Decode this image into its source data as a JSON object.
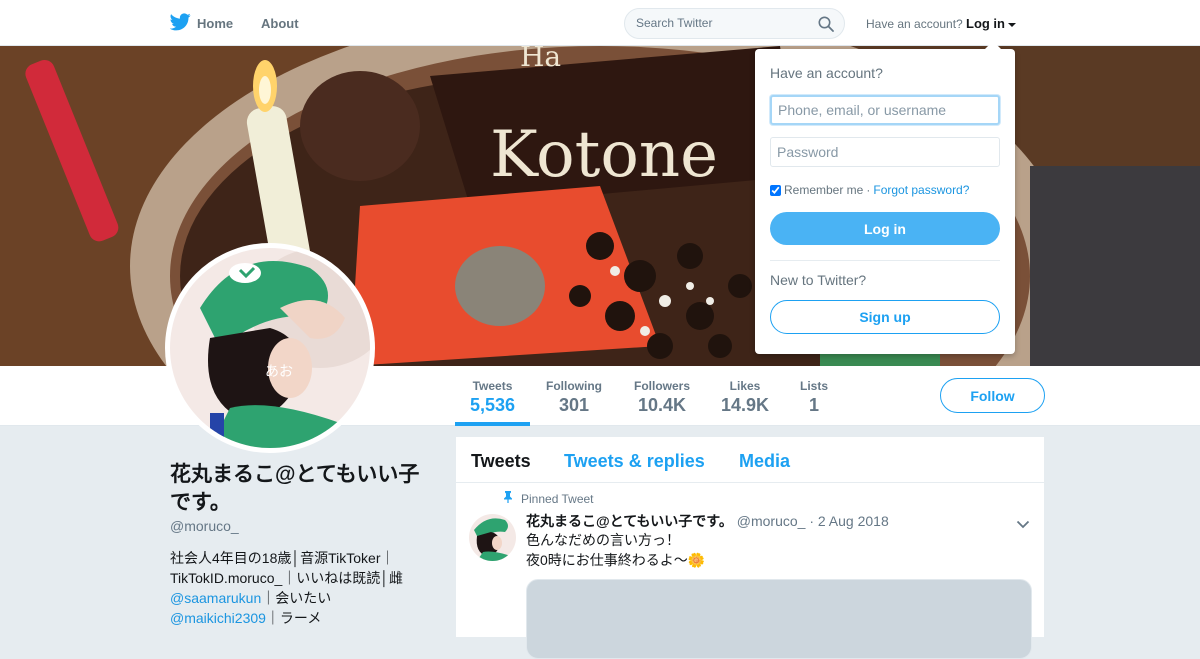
{
  "nav": {
    "home_label": "Home",
    "about_label": "About",
    "search_placeholder": "Search Twitter",
    "have_account_text": "Have an account?",
    "login_label": "Log in",
    "brand_color": "#1da1f2"
  },
  "banner": {
    "plaque_text": "Kotone",
    "plaque_prefix": "Ha"
  },
  "avatar": {
    "signature": "あお"
  },
  "profile": {
    "name": "花丸まるこ@とてもいい子です。",
    "handle": "@moruco_",
    "bio_parts": [
      "社会人4年目の18歳│音源TikToker｜TikTokID.moruco_｜いいねは既読│雌",
      "@saamarukun",
      "｜会いたい",
      "@maikichi2309",
      "｜ラーメ"
    ]
  },
  "stats": [
    {
      "label": "Tweets",
      "value": "5,536"
    },
    {
      "label": "Following",
      "value": "301"
    },
    {
      "label": "Followers",
      "value": "10.4K"
    },
    {
      "label": "Likes",
      "value": "14.9K"
    },
    {
      "label": "Lists",
      "value": "1"
    }
  ],
  "follow_label": "Follow",
  "timeline": {
    "tabs": [
      "Tweets",
      "Tweets & replies",
      "Media"
    ],
    "pinned_label": "Pinned Tweet",
    "tweet": {
      "name": "花丸まるこ@とてもいい子です。",
      "handle": "@moruco_",
      "separator": "·",
      "date": "2 Aug 2018",
      "line1": "色んなだめの言い方っ！",
      "line2": "夜0時にお仕事終わるよ〜🌼"
    }
  },
  "login_dropdown": {
    "title": "Have an account?",
    "username_placeholder": "Phone, email, or username",
    "password_placeholder": "Password",
    "remember_label": "Remember me",
    "remember_checked": true,
    "separator": "·",
    "forgot_label": "Forgot password?",
    "login_button": "Log in",
    "new_text": "New to Twitter?",
    "signup_button": "Sign up"
  }
}
